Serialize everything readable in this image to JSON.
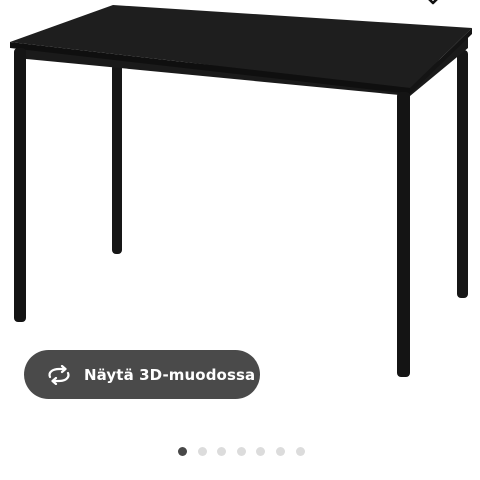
{
  "gallery": {
    "view_3d_label": "Näytä 3D-muodossa",
    "image_count": 7,
    "active_index": 0,
    "colors": {
      "button_bg": "#4a4a4a",
      "dot_active": "#484848",
      "dot_inactive": "#dcdcdc",
      "product": "#1c1c1c"
    }
  },
  "icons": {
    "wishlist": "heart-icon",
    "view_3d": "rotate-3d-icon"
  }
}
